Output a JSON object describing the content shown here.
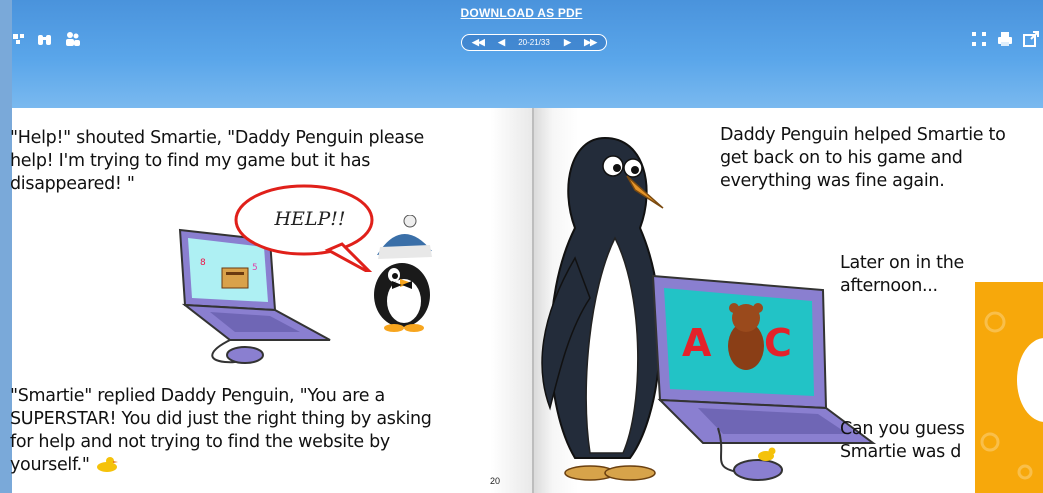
{
  "toolbar": {
    "download_label": "DOWNLOAD AS PDF",
    "page_indicator": "20-21/33",
    "first_label": "◀◀",
    "prev_label": "◀",
    "next_label": "▶",
    "last_label": "▶▶"
  },
  "left_page": {
    "paragraph_1": [
      "\"Help!\" shouted Smartie, \"Daddy Penguin please",
      "help! I'm trying to find my game but it has",
      "disappeared! \""
    ],
    "speech_bubble": "HELP!!",
    "paragraph_2": [
      "\"Smartie\" replied Daddy Penguin, \"You are a",
      "SUPERSTAR! You did just the right thing by asking",
      "for help and not trying to find the website by",
      "yourself.\""
    ],
    "page_number": "20"
  },
  "right_page": {
    "paragraph_1": [
      "Daddy Penguin helped Smartie to",
      "get back on to his game  and",
      "everything was fine again."
    ],
    "paragraph_2": [
      "Later on in the",
      "afternoon..."
    ],
    "paragraph_3": [
      "Can you guess",
      "Smartie was d"
    ],
    "screen_letters": [
      "A",
      "C"
    ]
  },
  "colors": {
    "toolbar_blue": "#5aa6ea",
    "laptop_purple": "#8a7fd0",
    "ad_orange": "#f7a80b"
  },
  "icons": [
    "share-icon",
    "binoculars-icon",
    "people-icon",
    "fullscreen-icon",
    "print-icon",
    "export-icon"
  ]
}
